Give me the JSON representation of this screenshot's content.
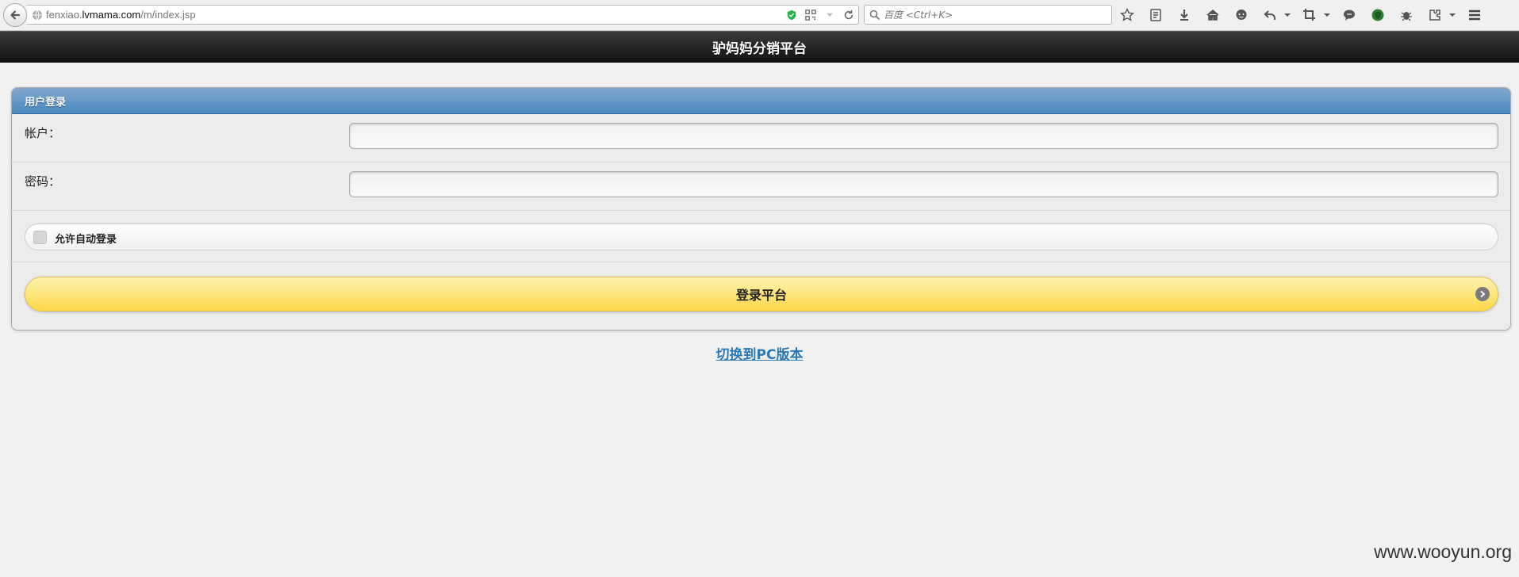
{
  "browser": {
    "url_domain_prefix": "fenxiao.",
    "url_domain": "lvmama.com",
    "url_path": "/m/index.jsp",
    "search_placeholder": "百度 <Ctrl+K>"
  },
  "header": {
    "title": "驴妈妈分销平台"
  },
  "login_panel": {
    "title": "用户登录",
    "account_label": "帐户：",
    "account_value": "",
    "password_label": "密码：",
    "password_value": "",
    "auto_login_label": "允许自动登录",
    "auto_login_checked": false,
    "submit_label": "登录平台"
  },
  "footer": {
    "switch_link": "切换到PC版本"
  },
  "watermark": "www.wooyun.org",
  "colors": {
    "header_bg": "#1a1a1a",
    "panel_head": "#4b87bf",
    "button_yellow": "#fcd849",
    "link": "#2a7ab8"
  }
}
